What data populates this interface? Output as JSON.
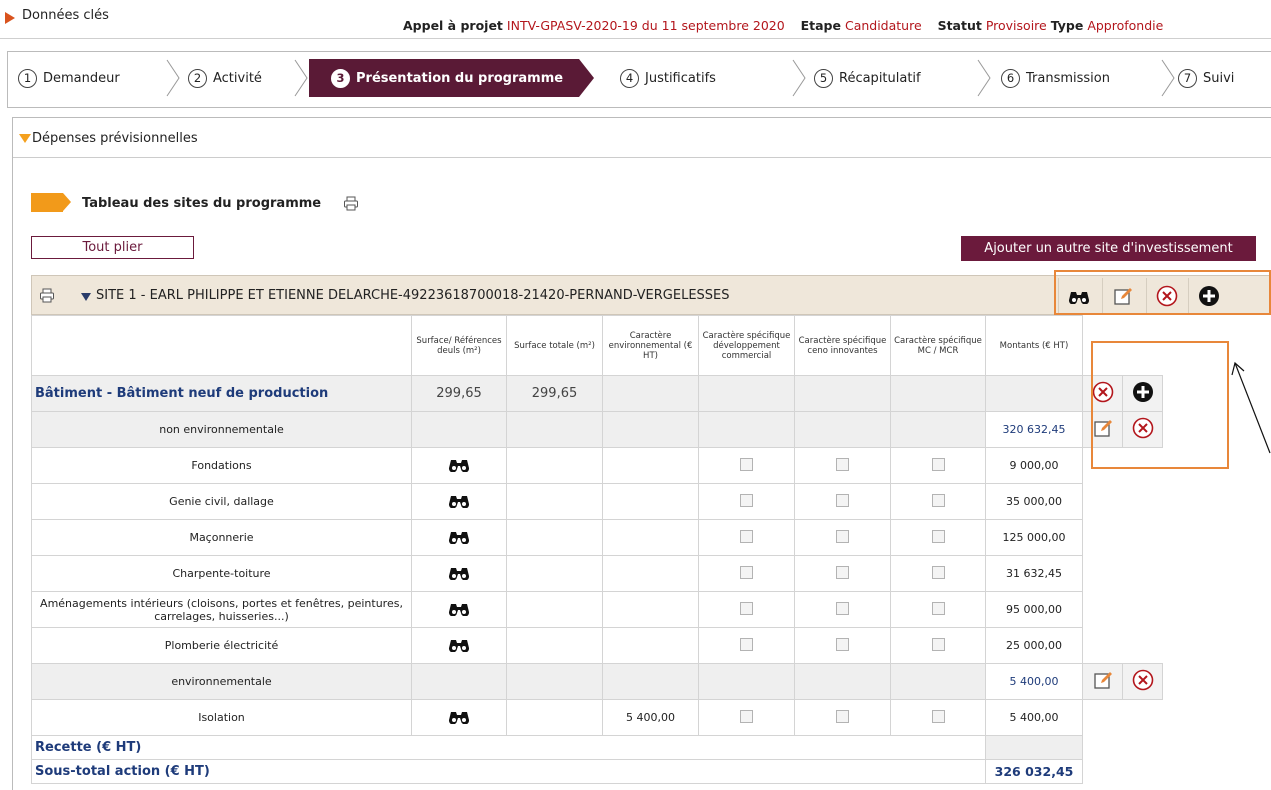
{
  "header": {
    "title": "Données clés",
    "appel_label": "Appel à projet",
    "appel_value": "INTV-GPASV-2020-19 du 11 septembre 2020",
    "etape_label": "Etape",
    "etape_value": "Candidature",
    "statut_label": "Statut",
    "statut_value": "Provisoire",
    "type_label": "Type",
    "type_value": "Approfondie"
  },
  "steps": [
    {
      "num": "1",
      "label": "Demandeur"
    },
    {
      "num": "2",
      "label": "Activité"
    },
    {
      "num": "3",
      "label": "Présentation du programme"
    },
    {
      "num": "4",
      "label": "Justificatifs"
    },
    {
      "num": "5",
      "label": "Récapitulatif"
    },
    {
      "num": "6",
      "label": "Transmission"
    },
    {
      "num": "7",
      "label": "Suivi"
    }
  ],
  "panel": {
    "title": "Dépenses prévisionnelles",
    "table_title": "Tableau des sites du programme",
    "collapse_all": "Tout plier",
    "add_site": "Ajouter un autre site d'investissement",
    "site_label": "SITE 1 - EARL PHILIPPE ET ETIENNE DELARCHE-49223618700018-21420-PERNAND-VERGELESSES"
  },
  "columns": [
    "",
    "Surface/ Références deuls (m²)",
    "Surface totale (m²)",
    "Caractère environnemental (€ HT)",
    "Caractère spécifique développement commercial",
    "Caractère spécifique ceno innovantes",
    "Caractère spécifique MC / MCR",
    "Montants (€ HT)"
  ],
  "rows": {
    "batiment": {
      "label": "Bâtiment - Bâtiment neuf de production",
      "surface": "299,65",
      "surface_totale": "299,65"
    },
    "non_env": {
      "label": "non environnementale",
      "montant": "320 632,45"
    },
    "items_non_env": [
      {
        "label": "Fondations",
        "montant": "9 000,00"
      },
      {
        "label": "Genie civil, dallage",
        "montant": "35 000,00"
      },
      {
        "label": "Maçonnerie",
        "montant": "125 000,00"
      },
      {
        "label": "Charpente-toiture",
        "montant": "31 632,45"
      },
      {
        "label": "Aménagements intérieurs (cloisons, portes et fenêtres, peintures, carrelages, huisseries...)",
        "montant": "95 000,00"
      },
      {
        "label": "Plomberie électricité",
        "montant": "25 000,00"
      }
    ],
    "env": {
      "label": "environnementale",
      "montant": "5 400,00"
    },
    "isolation": {
      "label": "Isolation",
      "env": "5 400,00",
      "montant": "5 400,00"
    },
    "recette": {
      "label": "Recette (€ HT)"
    },
    "sous_total": {
      "label": "Sous-total action (€ HT)",
      "montant": "326 032,45"
    }
  },
  "colors": {
    "accent": "#6b1a3c",
    "red_text": "#b3161c",
    "orange": "#f29a1a",
    "blue": "#1e3b7a",
    "highlight": "#e8873a"
  }
}
